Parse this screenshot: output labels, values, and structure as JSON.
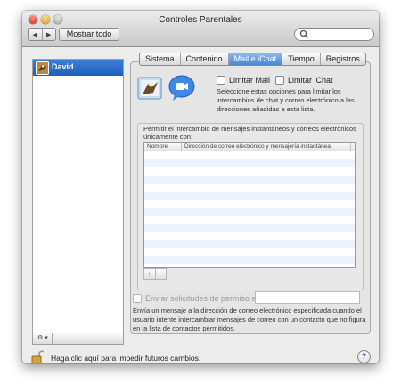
{
  "window": {
    "title": "Controles Parentales"
  },
  "toolbar": {
    "back_glyph": "◀",
    "forward_glyph": "▶",
    "show_all_label": "Mostrar todo",
    "search_placeholder": ""
  },
  "sidebar": {
    "users": [
      {
        "name": "David",
        "selected": true
      }
    ],
    "gear_label": "⚙ ▾"
  },
  "tabs": [
    {
      "label": "Sistema",
      "active": false
    },
    {
      "label": "Contenido",
      "active": false
    },
    {
      "label": "Mail e iChat",
      "active": true
    },
    {
      "label": "Tiempo",
      "active": false
    },
    {
      "label": "Registros",
      "active": false
    }
  ],
  "mail_ichat": {
    "limit_mail_label": "Limitar Mail",
    "limit_ichat_label": "Limitar iChat",
    "description": "Seleccione estas opciones para limitar los intercambios de chat y correo electrónico a las direcciones añadidas a esta lista.",
    "group_label": "Permitir el intercambio de mensajes instantáneos y correos electrónicos únicamente con:",
    "table": {
      "columns": [
        "Nombre",
        "Dirección de correo electrónico y mensajería instantánea"
      ],
      "rows": []
    },
    "add_label": "+",
    "remove_label": "−",
    "permission_label": "Enviar solicitudes de permiso a:",
    "permission_value": "",
    "permission_desc": "Envía un mensaje a la dirección de correo electrónico especificada cuando el usuario intente intercambiar mensajes de correo con un contacto que no figura en la lista de contactos permitidos."
  },
  "footer": {
    "lock_text": "Haga clic aquí para impedir futuros cambios.",
    "help_label": "?"
  },
  "colors": {
    "selection": "#3d7fd6",
    "window_bg": "#ececec",
    "stripe": "#edf3fe"
  }
}
